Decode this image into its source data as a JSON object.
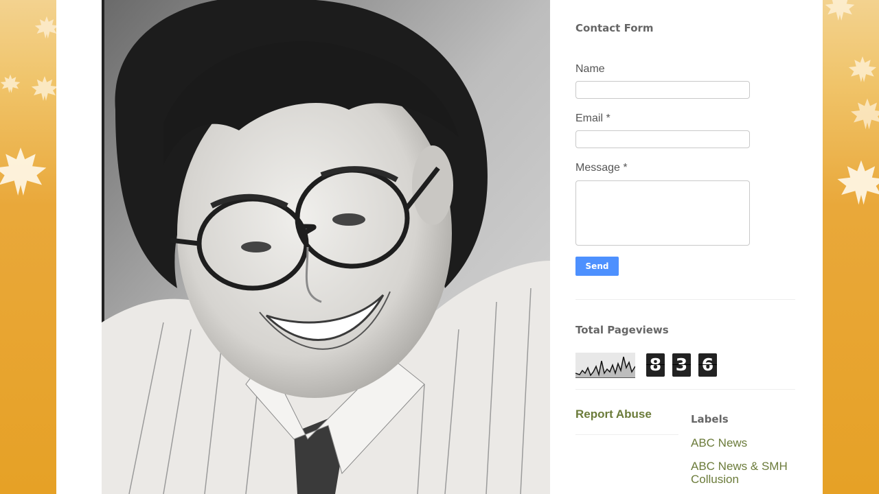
{
  "contact_form": {
    "title": "Contact Form",
    "name_label": "Name",
    "email_label": "Email *",
    "message_label": "Message *",
    "send_label": "Send"
  },
  "pageviews": {
    "title": "Total Pageviews",
    "digits": [
      "8",
      "3",
      "6"
    ]
  },
  "report_abuse": "Report Abuse",
  "labels": {
    "title": "Labels",
    "items": [
      "ABC News",
      "ABC News & SMH Collusion"
    ]
  },
  "colors": {
    "background_orange": "#e6a126",
    "link_green": "#6b7b3a",
    "send_blue": "#4d90fe"
  }
}
